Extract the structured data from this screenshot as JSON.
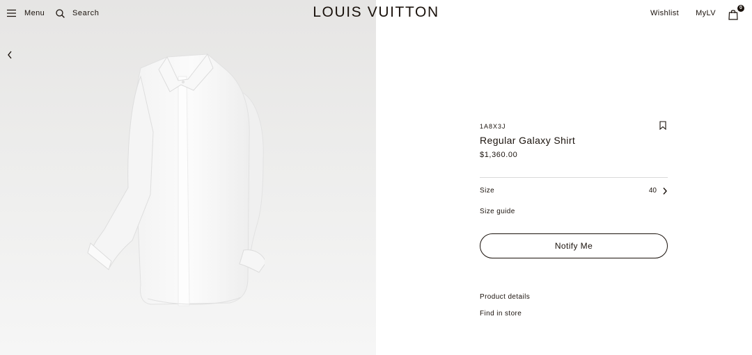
{
  "header": {
    "menu_label": "Menu",
    "search_label": "Search",
    "logo_text": "LOUIS VUITTON",
    "wishlist_label": "Wishlist",
    "mylv_label": "MyLV",
    "bag_count": "0"
  },
  "product": {
    "sku": "1A8X3J",
    "name": "Regular Galaxy Shirt",
    "price": "$1,360.00",
    "size_label": "Size",
    "size_value": "40",
    "size_guide_label": "Size guide",
    "notify_label": "Notify Me",
    "product_details_label": "Product details",
    "find_in_store_label": "Find in store"
  },
  "icons": {
    "menu": "hamburger-icon",
    "search": "search-icon",
    "bag": "shopping-bag-icon",
    "bookmark": "bookmark-icon",
    "size_chevron": "chevron-right-icon",
    "gallery_prev": "chevron-left-icon"
  },
  "colors": {
    "text": "#19110b",
    "image_bg": "#ebebea",
    "divider": "#d9d9d9"
  }
}
